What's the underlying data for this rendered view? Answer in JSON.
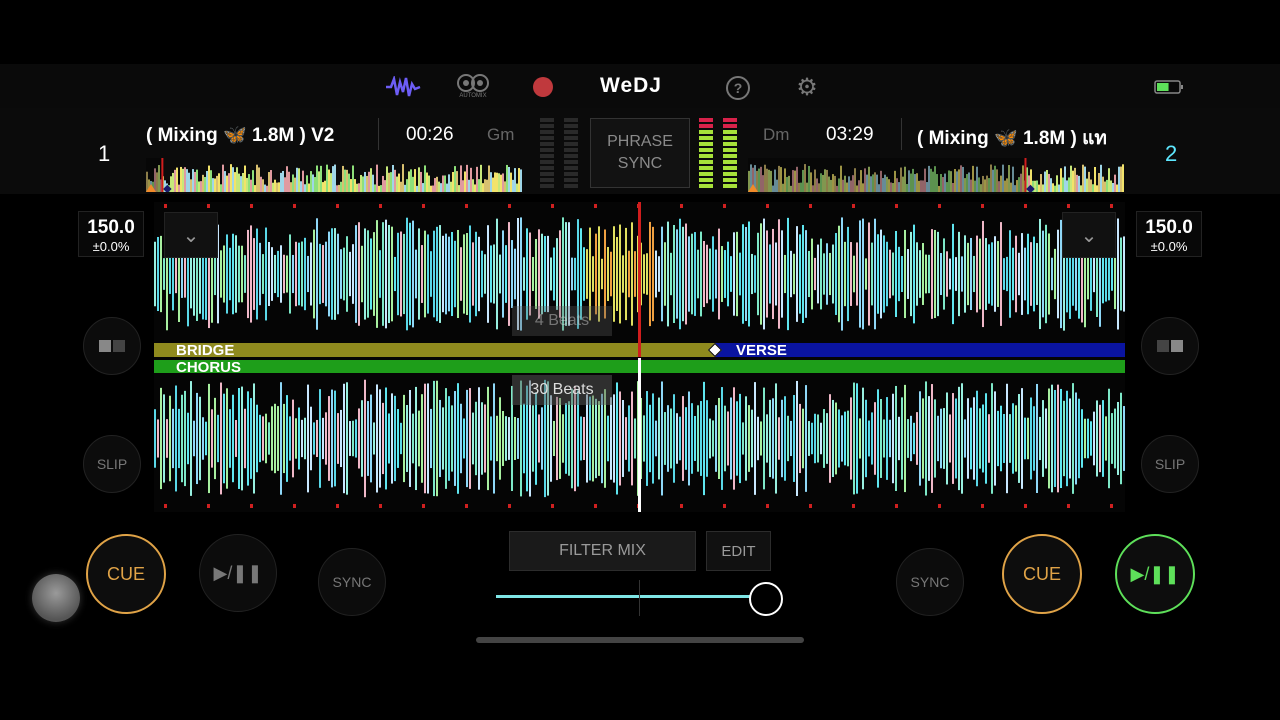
{
  "toolbar": {
    "waveform_icon": "waveform-icon",
    "automix_label": "AUTOMIX",
    "record_icon": "record-icon",
    "logo": "WeDJ",
    "help_icon": "help-icon",
    "settings_icon": "gear-icon",
    "battery_icon": "battery-icon",
    "battery_level": 0.55,
    "accent_color": "#6d5df5",
    "record_color": "#c0393d"
  },
  "deck1": {
    "number": "1",
    "track": "( Mixing 🦋 1.8M ) V2",
    "time": "00:26",
    "key": "Gm",
    "bpm": "150.0",
    "pitch": "±0.0%",
    "cue_label": "CUE",
    "play_label": "▶/❚❚",
    "sync_label": "SYNC",
    "slip_label": "SLIP",
    "progress": 0.04
  },
  "deck2": {
    "number": "2",
    "track": "( Mixing 🦋 1.8M ) แท",
    "time": "03:29",
    "key": "Dm",
    "bpm": "150.0",
    "pitch": "±0.0%",
    "cue_label": "CUE",
    "play_label": "▶/❚❚",
    "sync_label": "SYNC",
    "slip_label": "SLIP",
    "progress": 0.72,
    "number_color": "#5ee8ff"
  },
  "center": {
    "phrase_sync_line1": "PHRASE",
    "phrase_sync_line2": "SYNC",
    "filter_mix_label": "FILTER MIX",
    "edit_label": "EDIT",
    "crossfader_position": 0.95
  },
  "waveform": {
    "top_overlay": "4 Beats",
    "bottom_overlay": "30 Beats",
    "phrases_deck1": [
      "BRIDGE",
      "VERSE"
    ],
    "phrases_deck2": [
      "CHORUS"
    ],
    "bridge_color": "#8f8a1e",
    "verse_color": "#0a14a0",
    "chorus_color": "#1e9e1a"
  }
}
